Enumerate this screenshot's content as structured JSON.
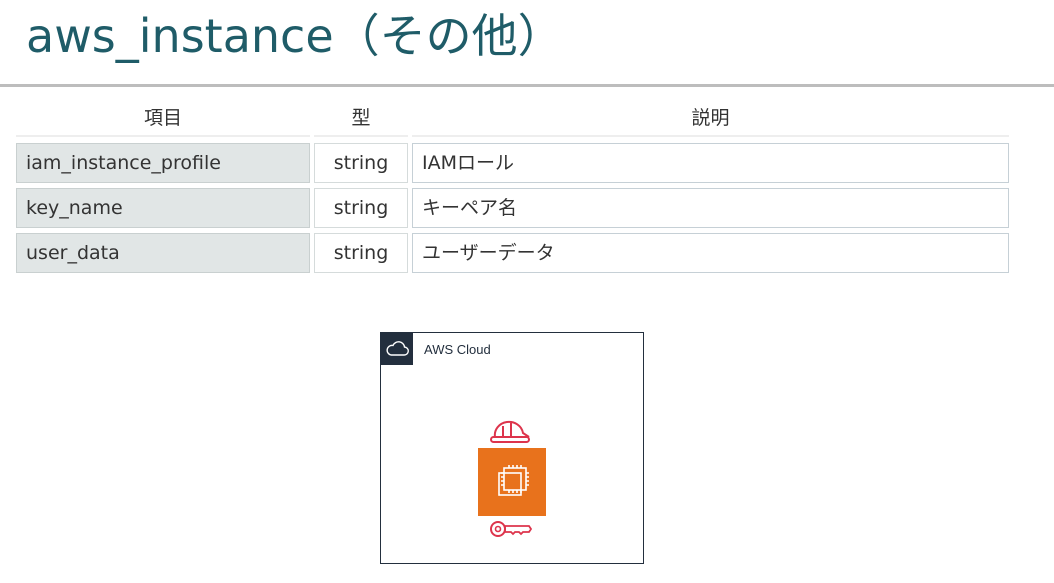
{
  "title": "aws_instance（その他）",
  "table": {
    "headers": {
      "item": "項目",
      "type": "型",
      "description": "説明"
    },
    "rows": [
      {
        "item": "iam_instance_profile",
        "type": "string",
        "description": "IAMロール"
      },
      {
        "item": "key_name",
        "type": "string",
        "description": "キーペア名"
      },
      {
        "item": "user_data",
        "type": "string",
        "description": "ユーザーデータ"
      }
    ]
  },
  "diagram": {
    "group_label": "AWS Cloud",
    "icons": [
      "cloud-icon",
      "iam-role-helmet-icon",
      "ec2-instance-icon",
      "key-pair-icon"
    ],
    "colors": {
      "group_border": "#232f3e",
      "ec2": "#e8721c",
      "iam": "#dd344c",
      "title": "#1f5c68"
    }
  }
}
